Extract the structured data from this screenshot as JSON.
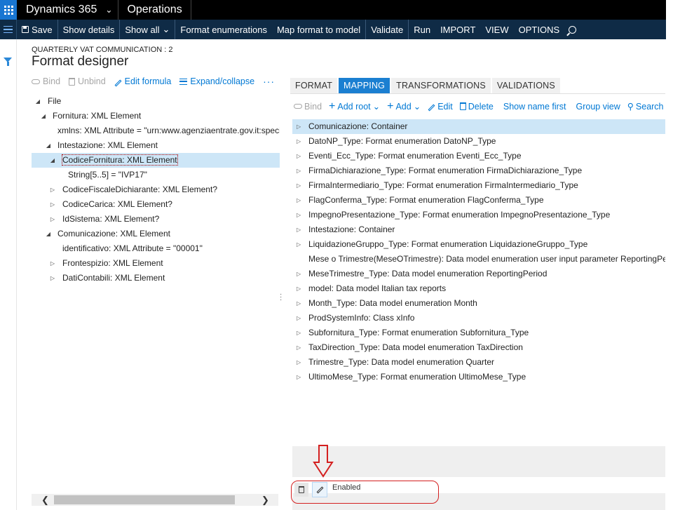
{
  "topbar": {
    "app_name": "Dynamics 365",
    "module": "Operations"
  },
  "actionbar": {
    "items": [
      {
        "label": "Save",
        "icon": "save-icon"
      },
      {
        "label": "Show details"
      },
      {
        "label": "Show all",
        "chevron": true
      },
      {
        "label": "Format enumerations"
      },
      {
        "label": "Map format to model"
      },
      {
        "label": "Validate"
      },
      {
        "label": "Run"
      },
      {
        "label": "IMPORT"
      },
      {
        "label": "VIEW"
      },
      {
        "label": "OPTIONS"
      }
    ]
  },
  "page": {
    "caption": "QUARTERLY VAT COMMUNICATION : 2",
    "title": "Format designer"
  },
  "left_toolbar": {
    "bind": "Bind",
    "unbind": "Unbind",
    "edit_formula": "Edit formula",
    "expand_collapse": "Expand/collapse",
    "more": "···"
  },
  "format_tree": [
    {
      "label": "File",
      "level": 0,
      "toggle": "expanded"
    },
    {
      "label": "Fornitura: XML Element",
      "level": 1,
      "toggle": "expanded"
    },
    {
      "label": "xmlns: XML Attribute = \"urn:www.agenziaentrate.gov.it:specificheTecniche\"",
      "level": 2,
      "toggle": "none"
    },
    {
      "label": "Intestazione: XML Element",
      "level": 2,
      "toggle": "expanded"
    },
    {
      "label": "CodiceFornitura: XML Element",
      "level": 3,
      "toggle": "expanded",
      "selected": true
    },
    {
      "label": "String[5..5] = \"IVP17\"",
      "level": 4,
      "toggle": "none"
    },
    {
      "label": "CodiceFiscaleDichiarante: XML Element?",
      "level": 3,
      "toggle": "collapsed"
    },
    {
      "label": "CodiceCarica: XML Element?",
      "level": 3,
      "toggle": "collapsed"
    },
    {
      "label": "IdSistema: XML Element?",
      "level": 3,
      "toggle": "collapsed"
    },
    {
      "label": "Comunicazione: XML Element",
      "level": 2,
      "toggle": "expanded"
    },
    {
      "label": "identificativo: XML Attribute = \"00001\"",
      "level": 3,
      "toggle": "none"
    },
    {
      "label": "Frontespizio: XML Element",
      "level": 3,
      "toggle": "collapsed"
    },
    {
      "label": "DatiContabili: XML Element",
      "level": 3,
      "toggle": "collapsed"
    }
  ],
  "tabs": [
    {
      "label": "FORMAT",
      "active": false
    },
    {
      "label": "MAPPING",
      "active": true
    },
    {
      "label": "TRANSFORMATIONS",
      "active": false
    },
    {
      "label": "VALIDATIONS",
      "active": false
    }
  ],
  "right_toolbar": {
    "bind": "Bind",
    "add_root": "Add root",
    "add": "Add",
    "edit": "Edit",
    "delete": "Delete",
    "show_name_first": "Show name first",
    "group_view": "Group view",
    "search": "Search"
  },
  "mapping_list": [
    {
      "label": "Comunicazione: Container",
      "selected": true
    },
    {
      "label": "DatoNP_Type: Format enumeration DatoNP_Type"
    },
    {
      "label": "Eventi_Ecc_Type: Format enumeration Eventi_Ecc_Type"
    },
    {
      "label": "FirmaDichiarazione_Type: Format enumeration FirmaDichiarazione_Type"
    },
    {
      "label": "FirmaIntermediario_Type: Format enumeration FirmaIntermediario_Type"
    },
    {
      "label": "FlagConferma_Type: Format enumeration FlagConferma_Type"
    },
    {
      "label": "ImpegnoPresentazione_Type: Format enumeration ImpegnoPresentazione_Type"
    },
    {
      "label": "Intestazione: Container"
    },
    {
      "label": "LiquidazioneGruppo_Type: Format enumeration LiquidazioneGruppo_Type"
    },
    {
      "label": "Mese o Trimestre(MeseOTrimestre): Data model enumeration user input parameter ReportingPeriod",
      "no_toggle": true
    },
    {
      "label": "MeseTrimestre_Type: Data model enumeration ReportingPeriod"
    },
    {
      "label": "model: Data model Italian tax reports"
    },
    {
      "label": "Month_Type: Data model enumeration Month"
    },
    {
      "label": "ProdSystemInfo: Class xInfo"
    },
    {
      "label": "Subfornitura_Type: Format enumeration Subfornitura_Type"
    },
    {
      "label": "TaxDirection_Type: Data model enumeration TaxDirection"
    },
    {
      "label": "Trimestre_Type: Data model enumeration Quarter"
    },
    {
      "label": "UltimoMese_Type: Format enumeration UltimoMese_Type"
    }
  ],
  "bottom": {
    "enabled_label": "Enabled"
  },
  "colors": {
    "topbar": "#000000",
    "actionbar": "#0f2b46",
    "accent": "#0078d4",
    "selection": "#cde6f7",
    "callout": "#d42020"
  }
}
